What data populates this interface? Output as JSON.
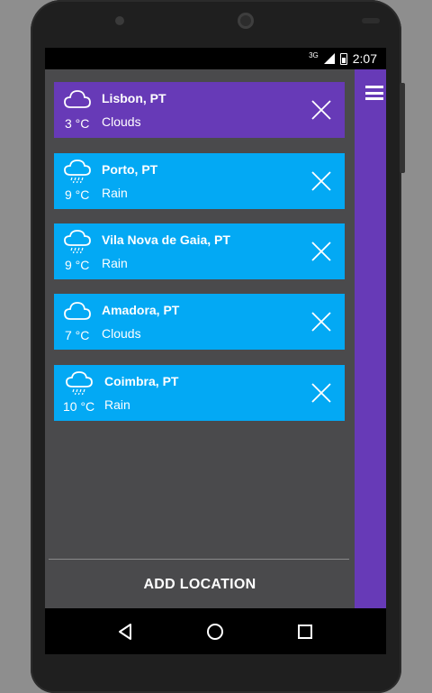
{
  "status_bar": {
    "network": "3G",
    "time": "2:07"
  },
  "locations": [
    {
      "city": "Lisbon, PT",
      "temp": "3 °C",
      "condition": "Clouds",
      "icon": "cloud-icon",
      "color": "#673ab7"
    },
    {
      "city": "Porto, PT",
      "temp": "9 °C",
      "condition": "Rain",
      "icon": "rain-icon",
      "color": "#03a9f4"
    },
    {
      "city": "Vila Nova de Gaia, PT",
      "temp": "9 °C",
      "condition": "Rain",
      "icon": "rain-icon",
      "color": "#03a9f4"
    },
    {
      "city": "Amadora, PT",
      "temp": "7 °C",
      "condition": "Clouds",
      "icon": "cloud-icon",
      "color": "#03a9f4"
    },
    {
      "city": "Coimbra, PT",
      "temp": "10 °C",
      "condition": "Rain",
      "icon": "rain-icon",
      "color": "#03a9f4"
    }
  ],
  "footer": {
    "add_label": "ADD LOCATION"
  },
  "colors": {
    "accent": "#673ab7",
    "card": "#03a9f4"
  }
}
